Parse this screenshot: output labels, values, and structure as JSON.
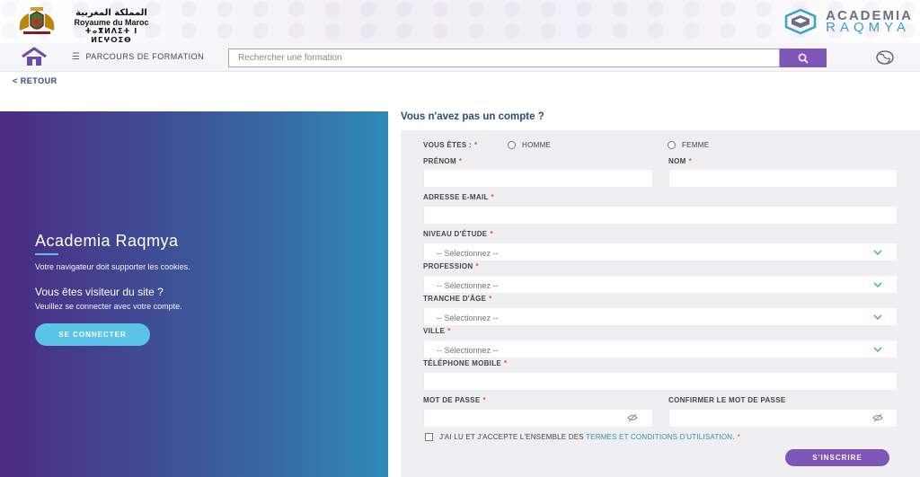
{
  "header": {
    "kingdom_arabic": "المملكة المغربية",
    "kingdom_french": "Royaume du Maroc",
    "kingdom_tifinagh": "ⵜⴰⴳⵍⴷⵉⵜ ⵏ ⵍⵎⵖⵔⵉⴱ",
    "brand_line1": "ACADEMIA",
    "brand_line2": "RAQMYA"
  },
  "nav": {
    "parcours_label": "PARCOURS DE FORMATION",
    "search_placeholder": "Rechercher une formation"
  },
  "back_label": "< RETOUR",
  "hero": {
    "title": "Academia Raqmya",
    "cookie_notice": "Votre navigateur doit supporter les cookies.",
    "visitor_question": "Vous êtes visiteur du site ?",
    "connect_prompt": "Veuillez se connecter avec votre compte.",
    "connect_button": "SE CONNECTER"
  },
  "form": {
    "heading": "Vous n'avez pas un compte ?",
    "required_mark": "*",
    "vous_etes": "VOUS ÊTES :",
    "homme": "HOMME",
    "femme": "FEMME",
    "prenom": "PRÉNOM",
    "nom": "NOM",
    "email": "ADRESSE E-MAIL",
    "niveau": "NIVEAU D'ÉTUDE",
    "profession": "PROFESSION",
    "tranche": "TRANCHE D'ÂGE",
    "ville": "VILLE",
    "telephone": "TÉLÉPHONE MOBILE",
    "mot_de_passe": "MOT DE PASSE",
    "confirmer": "CONFIRMER LE MOT DE PASSE",
    "select_placeholder": "-- Sélectionnez --",
    "terms_prefix": "J'AI LU ET J'ACCEPTE L'ENSEMBLE DES ",
    "terms_link": "TERMES ET CONDITIONS D'UTILISATION",
    "terms_suffix": ".",
    "submit": "S'INSCRIRE"
  },
  "colors": {
    "accent_purple": "#7e56b8",
    "accent_cyan": "#5bc3e8",
    "heading_blue": "#2e4a7a"
  }
}
